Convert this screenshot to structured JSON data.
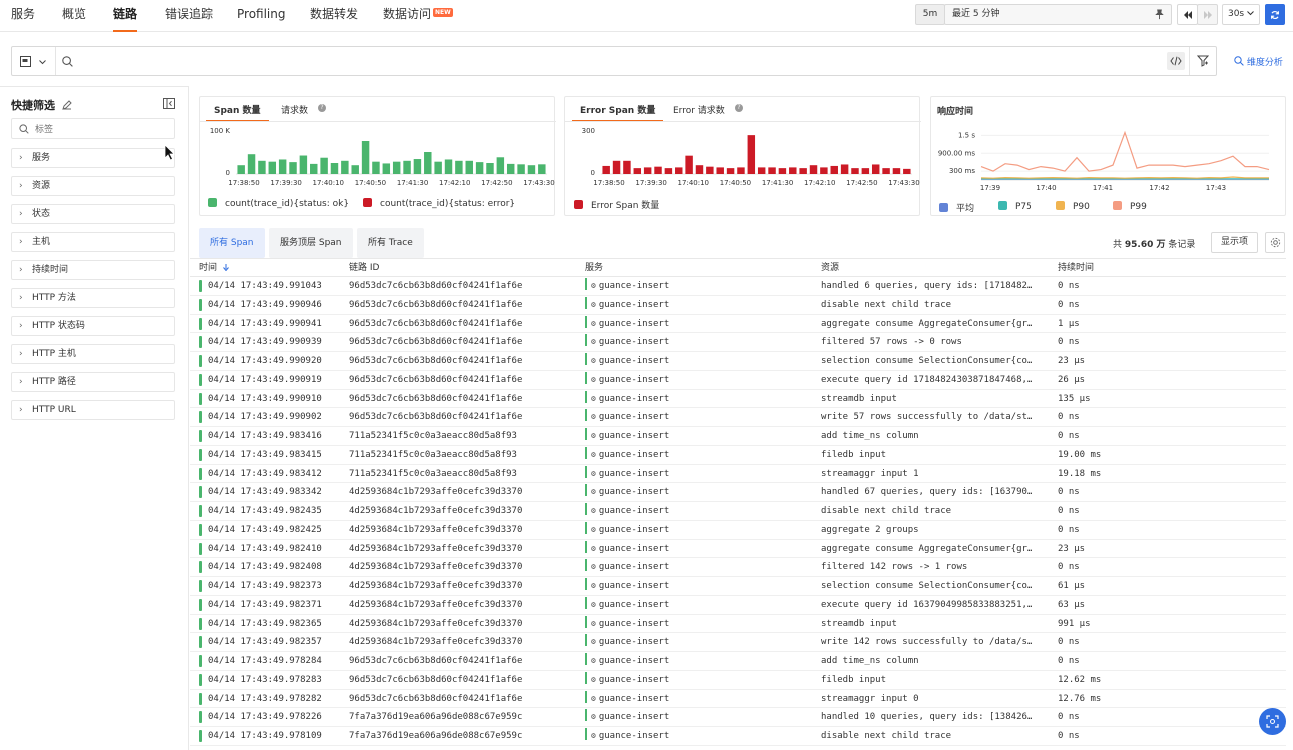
{
  "nav": {
    "items": [
      "服务",
      "概览",
      "链路",
      "错误追踪",
      "Profiling",
      "数据转发",
      "数据访问"
    ],
    "active": "链路",
    "new_badge": "NEW"
  },
  "time": {
    "preset": "5m",
    "range": "最近 5 分钟",
    "refresh_interval": "30s"
  },
  "search": {
    "placeholder": ""
  },
  "dimension_analysis": "维度分析",
  "sidebar": {
    "title": "快捷筛选",
    "tag_placeholder": "标签",
    "items": [
      "服务",
      "资源",
      "状态",
      "主机",
      "持续时间",
      "HTTP 方法",
      "HTTP 状态码",
      "HTTP 主机",
      "HTTP 路径",
      "HTTP URL"
    ]
  },
  "colors": {
    "ok": "#4ab56d",
    "error": "#cc1a26",
    "accent": "#f26a1b",
    "link": "#2f6de0",
    "avg": "#6283d6",
    "p75": "#3bb8b0",
    "p90": "#f0b450",
    "p99": "#f49c82"
  },
  "chart_data": [
    {
      "type": "bar",
      "tabs": [
        "Span 数量",
        "请求数"
      ],
      "active_tab": "Span 数量",
      "ylim": [
        0,
        100000
      ],
      "yticks": [
        "100 K",
        "0"
      ],
      "xticks": [
        "17:38:50",
        "17:39:30",
        "17:40:10",
        "17:40:50",
        "17:41:30",
        "17:42:10",
        "17:42:50",
        "17:43:30"
      ],
      "series": [
        {
          "name": "count(trace_id){status: ok}",
          "color": "#4ab56d",
          "values": [
            20000,
            45000,
            30000,
            28000,
            33000,
            27000,
            42000,
            23000,
            37000,
            25000,
            30000,
            20000,
            75000,
            28000,
            24000,
            28000,
            30000,
            34000,
            50000,
            28000,
            33000,
            30000,
            30000,
            27000,
            25000,
            38000,
            23000,
            22000,
            20000,
            22000
          ]
        },
        {
          "name": "count(trace_id){status: error}",
          "color": "#cc1a26",
          "values": []
        }
      ]
    },
    {
      "type": "bar",
      "tabs": [
        "Error Span 数量",
        "Error 请求数"
      ],
      "active_tab": "Error Span 数量",
      "ylim": [
        0,
        300
      ],
      "yticks": [
        "300",
        "0"
      ],
      "xticks": [
        "17:38:50",
        "17:39:30",
        "17:40:10",
        "17:40:50",
        "17:41:30",
        "17:42:10",
        "17:42:50",
        "17:43:30"
      ],
      "series": [
        {
          "name": "Error Span 数量",
          "color": "#cc1a26",
          "values": [
            55,
            90,
            90,
            40,
            45,
            50,
            40,
            45,
            125,
            60,
            50,
            45,
            40,
            45,
            265,
            45,
            45,
            40,
            45,
            40,
            60,
            45,
            55,
            65,
            40,
            40,
            65,
            40,
            40,
            35
          ]
        }
      ]
    },
    {
      "type": "line",
      "title": "响应时间",
      "yticks": [
        "1.5 s",
        "900.00 ms",
        "300 ms"
      ],
      "xticks": [
        "17:39",
        "17:40",
        "17:41",
        "17:42",
        "17:43"
      ],
      "series": [
        {
          "name": "平均",
          "color": "#6283d6",
          "values": [
            0.03,
            0.03,
            0.03,
            0.03,
            0.03,
            0.03,
            0.03,
            0.03,
            0.03,
            0.03,
            0.03,
            0.03,
            0.03,
            0.03,
            0.03,
            0.03,
            0.03,
            0.03,
            0.03,
            0.03,
            0.03,
            0.03,
            0.03,
            0.03,
            0.03
          ]
        },
        {
          "name": "P75",
          "color": "#3bb8b0",
          "values": [
            0.04,
            0.04,
            0.04,
            0.04,
            0.04,
            0.04,
            0.04,
            0.04,
            0.04,
            0.04,
            0.04,
            0.04,
            0.04,
            0.04,
            0.04,
            0.04,
            0.04,
            0.04,
            0.04,
            0.04,
            0.04,
            0.04,
            0.04,
            0.04,
            0.04
          ]
        },
        {
          "name": "P90",
          "color": "#f0b450",
          "values": [
            0.07,
            0.06,
            0.08,
            0.07,
            0.06,
            0.07,
            0.08,
            0.07,
            0.06,
            0.08,
            0.07,
            0.07,
            0.06,
            0.07,
            0.08,
            0.07,
            0.08,
            0.07,
            0.06,
            0.08,
            0.07,
            0.1,
            0.07,
            0.07,
            0.07
          ]
        },
        {
          "name": "P99",
          "color": "#f49c82",
          "values": [
            0.45,
            0.3,
            0.55,
            0.5,
            0.35,
            0.45,
            0.4,
            0.3,
            0.75,
            0.3,
            0.35,
            0.5,
            1.6,
            0.4,
            0.5,
            0.5,
            0.5,
            0.45,
            0.5,
            0.55,
            0.65,
            0.8,
            0.45,
            0.45,
            0.35
          ]
        }
      ]
    }
  ],
  "view_tabs": [
    "所有 Span",
    "服务顶层 Span",
    "所有 Trace"
  ],
  "active_view_tab": "所有 Span",
  "records": {
    "prefix": "共",
    "count": "95.60 万",
    "suffix": "条记录"
  },
  "display_items": "显示项",
  "table": {
    "columns": [
      "时间",
      "链路 ID",
      "服务",
      "资源",
      "持续时间"
    ],
    "rows": [
      [
        "04/14 17:43:49.991043",
        "96d53dc7c6cb63b8d60cf04241f1af6e",
        "guance-insert",
        "handled 6 queries, query ids: [1718482…",
        "0 ns"
      ],
      [
        "04/14 17:43:49.990946",
        "96d53dc7c6cb63b8d60cf04241f1af6e",
        "guance-insert",
        "disable next child trace",
        "0 ns"
      ],
      [
        "04/14 17:43:49.990941",
        "96d53dc7c6cb63b8d60cf04241f1af6e",
        "guance-insert",
        "aggregate consume AggregateConsumer{gr…",
        "1 µs"
      ],
      [
        "04/14 17:43:49.990939",
        "96d53dc7c6cb63b8d60cf04241f1af6e",
        "guance-insert",
        "filtered 57 rows -> 0 rows",
        "0 ns"
      ],
      [
        "04/14 17:43:49.990920",
        "96d53dc7c6cb63b8d60cf04241f1af6e",
        "guance-insert",
        "selection consume SelectionConsumer{co…",
        "23 µs"
      ],
      [
        "04/14 17:43:49.990919",
        "96d53dc7c6cb63b8d60cf04241f1af6e",
        "guance-insert",
        "execute query id 17184824303871847468,…",
        "26 µs"
      ],
      [
        "04/14 17:43:49.990910",
        "96d53dc7c6cb63b8d60cf04241f1af6e",
        "guance-insert",
        "streamdb input",
        "135 µs"
      ],
      [
        "04/14 17:43:49.990902",
        "96d53dc7c6cb63b8d60cf04241f1af6e",
        "guance-insert",
        "write 57 rows successfully to /data/st…",
        "0 ns"
      ],
      [
        "04/14 17:43:49.983416",
        "711a52341f5c0c0a3aeacc80d5a8f93",
        "guance-insert",
        "add time_ns column",
        "0 ns"
      ],
      [
        "04/14 17:43:49.983415",
        "711a52341f5c0c0a3aeacc80d5a8f93",
        "guance-insert",
        "filedb input",
        "19.00 ms"
      ],
      [
        "04/14 17:43:49.983412",
        "711a52341f5c0c0a3aeacc80d5a8f93",
        "guance-insert",
        "streamaggr input 1",
        "19.18 ms"
      ],
      [
        "04/14 17:43:49.983342",
        "4d2593684c1b7293affe0cefc39d3370",
        "guance-insert",
        "handled 67 queries, query ids: [163790…",
        "0 ns"
      ],
      [
        "04/14 17:43:49.982435",
        "4d2593684c1b7293affe0cefc39d3370",
        "guance-insert",
        "disable next child trace",
        "0 ns"
      ],
      [
        "04/14 17:43:49.982425",
        "4d2593684c1b7293affe0cefc39d3370",
        "guance-insert",
        "aggregate 2 groups",
        "0 ns"
      ],
      [
        "04/14 17:43:49.982410",
        "4d2593684c1b7293affe0cefc39d3370",
        "guance-insert",
        "aggregate consume AggregateConsumer{gr…",
        "23 µs"
      ],
      [
        "04/14 17:43:49.982408",
        "4d2593684c1b7293affe0cefc39d3370",
        "guance-insert",
        "filtered 142 rows -> 1 rows",
        "0 ns"
      ],
      [
        "04/14 17:43:49.982373",
        "4d2593684c1b7293affe0cefc39d3370",
        "guance-insert",
        "selection consume SelectionConsumer{co…",
        "61 µs"
      ],
      [
        "04/14 17:43:49.982371",
        "4d2593684c1b7293affe0cefc39d3370",
        "guance-insert",
        "execute query id 16379049985833883251,…",
        "63 µs"
      ],
      [
        "04/14 17:43:49.982365",
        "4d2593684c1b7293affe0cefc39d3370",
        "guance-insert",
        "streamdb input",
        "991 µs"
      ],
      [
        "04/14 17:43:49.982357",
        "4d2593684c1b7293affe0cefc39d3370",
        "guance-insert",
        "write 142 rows successfully to /data/s…",
        "0 ns"
      ],
      [
        "04/14 17:43:49.978284",
        "96d53dc7c6cb63b8d60cf04241f1af6e",
        "guance-insert",
        "add time_ns column",
        "0 ns"
      ],
      [
        "04/14 17:43:49.978283",
        "96d53dc7c6cb63b8d60cf04241f1af6e",
        "guance-insert",
        "filedb input",
        "12.62 ms"
      ],
      [
        "04/14 17:43:49.978282",
        "96d53dc7c6cb63b8d60cf04241f1af6e",
        "guance-insert",
        "streamaggr input 0",
        "12.76 ms"
      ],
      [
        "04/14 17:43:49.978226",
        "7fa7a376d19ea606a96de088c67e959c",
        "guance-insert",
        "handled 10 queries, query ids: [138426…",
        "0 ns"
      ],
      [
        "04/14 17:43:49.978109",
        "7fa7a376d19ea606a96de088c67e959c",
        "guance-insert",
        "disable next child trace",
        "0 ns"
      ]
    ]
  }
}
